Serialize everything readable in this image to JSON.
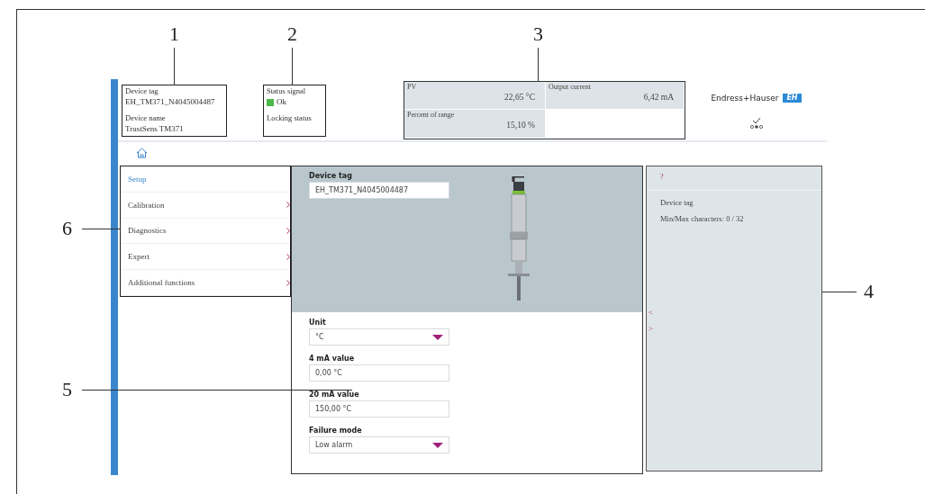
{
  "callouts": [
    {
      "label": "1"
    },
    {
      "label": "2"
    },
    {
      "label": "3"
    },
    {
      "label": "4"
    },
    {
      "label": "5"
    },
    {
      "label": "6"
    }
  ],
  "header": {
    "device": [
      {
        "label": "Device tag",
        "value": "EH_TM371_N4045004487"
      },
      {
        "label": "Device name",
        "value": "TrustSens TM371"
      }
    ],
    "status": {
      "label": "Status signal",
      "value": "Ok",
      "ok": true,
      "locking_label": "Locking status"
    },
    "measurements": [
      {
        "label": "PV",
        "value": "22,65 °C"
      },
      {
        "label": "Output current",
        "value": "6,42 mA"
      },
      {
        "label": "Percent of range",
        "value": "15,10 %"
      }
    ],
    "logo": {
      "name": "Endress+Hauser",
      "mark": "EH"
    }
  },
  "menu": [
    {
      "label": "Setup",
      "selected": true,
      "has_submenu": false
    },
    {
      "label": "Calibration",
      "selected": false,
      "has_submenu": true
    },
    {
      "label": "Diagnostics",
      "selected": false,
      "has_submenu": true
    },
    {
      "label": "Expert",
      "selected": false,
      "has_submenu": true
    },
    {
      "label": "Additional functions",
      "selected": false,
      "has_submenu": true
    }
  ],
  "form": {
    "device_tag": {
      "label": "Device tag",
      "value": "EH_TM371_N4045004487"
    },
    "fields": [
      {
        "kind": "select",
        "label": "Unit",
        "value": "°C"
      },
      {
        "kind": "input",
        "label": "4 mA value",
        "value": "0,00 °C"
      },
      {
        "kind": "input",
        "label": "20 mA value",
        "value": "150,00 °C"
      },
      {
        "kind": "select",
        "label": "Failure mode",
        "value": "Low alarm"
      }
    ]
  },
  "help": {
    "title": "?",
    "lines": [
      "Device tag",
      "Min/Max characters: 0 / 32"
    ],
    "nav": [
      "<",
      ">"
    ]
  }
}
